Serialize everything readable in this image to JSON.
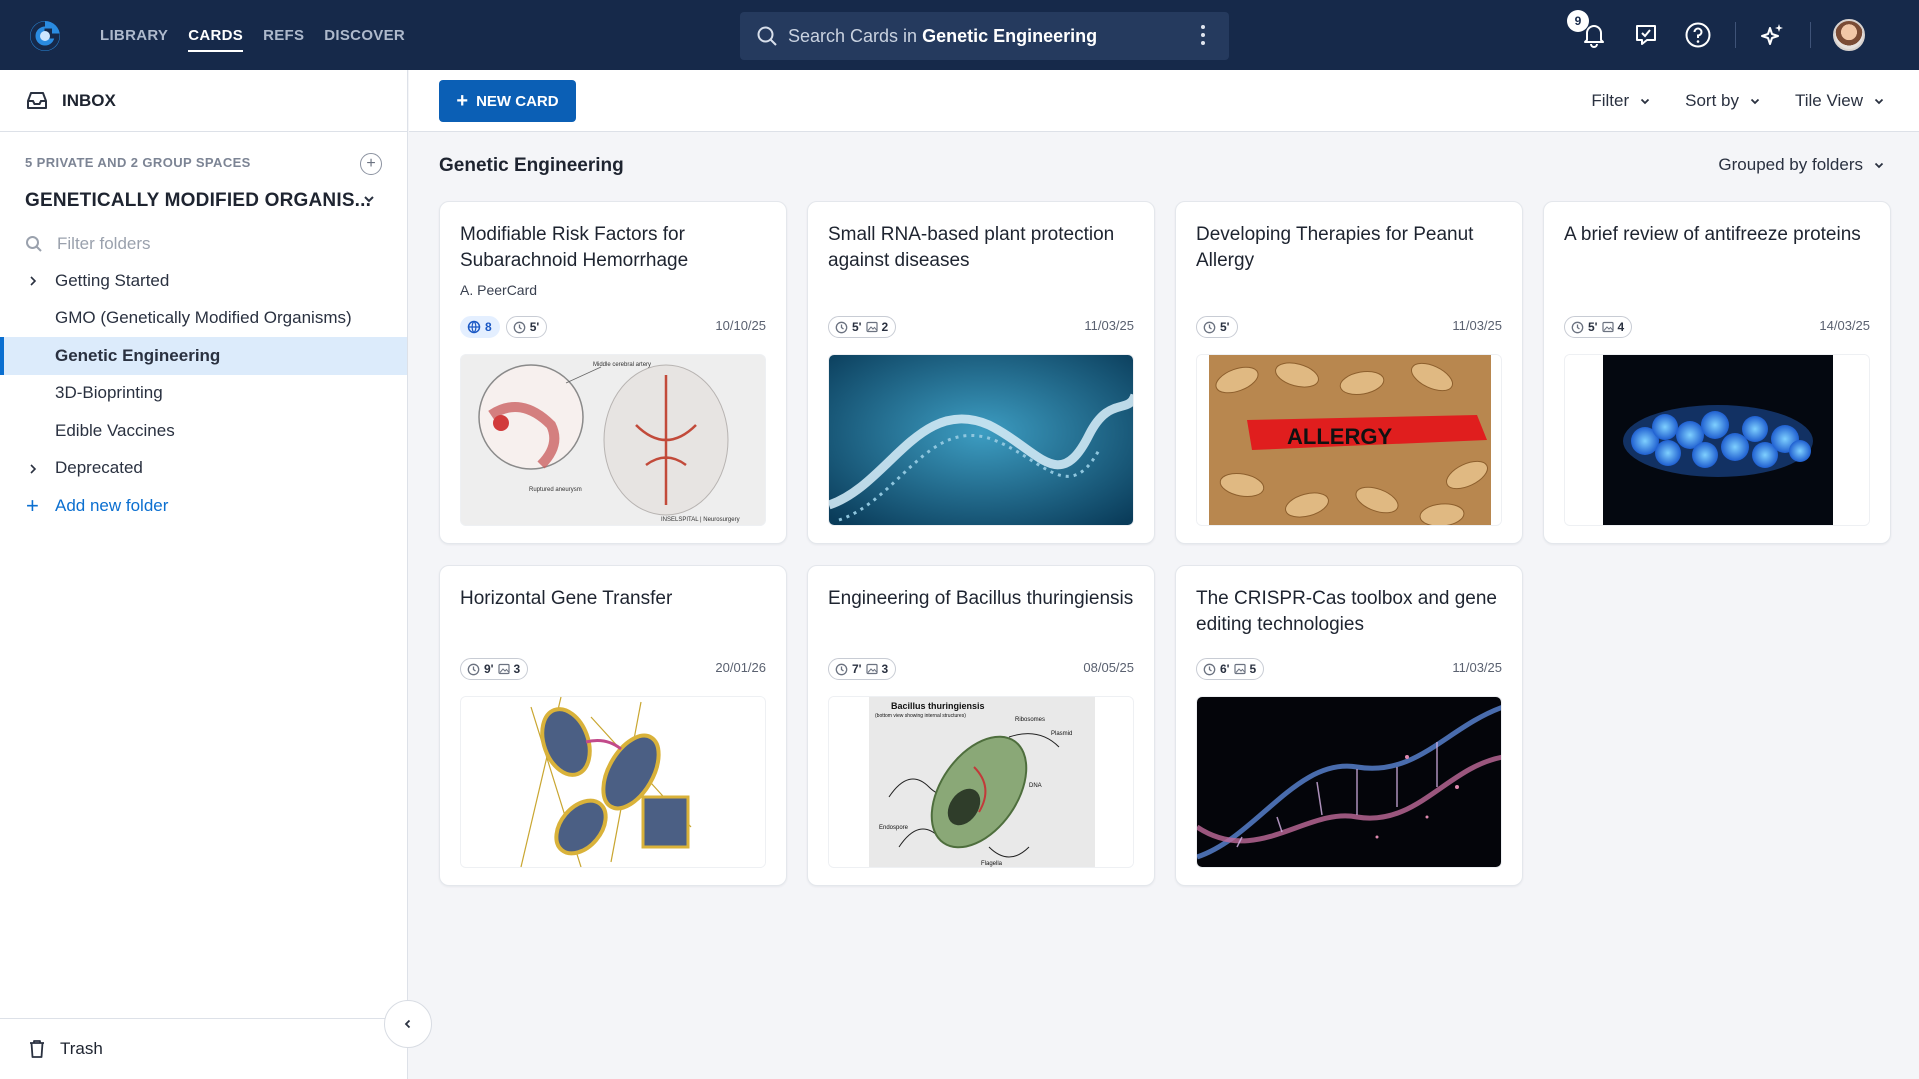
{
  "nav": {
    "items": [
      {
        "label": "LIBRARY",
        "active": false
      },
      {
        "label": "CARDS",
        "active": true
      },
      {
        "label": "REFS",
        "active": false
      },
      {
        "label": "DISCOVER",
        "active": false
      }
    ]
  },
  "search": {
    "prefix": "Search Cards in",
    "scope": "Genetic Engineering"
  },
  "notifications": {
    "count": "9"
  },
  "sidebar": {
    "inbox_label": "INBOX",
    "spaces_label": "5 PRIVATE AND 2 GROUP SPACES",
    "space_name": "GENETICALLY MODIFIED ORGANIS...",
    "filter_placeholder": "Filter folders",
    "folders": [
      {
        "label": "Getting Started",
        "expandable": true,
        "selected": false
      },
      {
        "label": "GMO (Genetically Modified Organisms)",
        "expandable": false,
        "selected": false
      },
      {
        "label": "Genetic Engineering",
        "expandable": false,
        "selected": true
      },
      {
        "label": "3D-Bioprinting",
        "expandable": false,
        "selected": false
      },
      {
        "label": "Edible Vaccines",
        "expandable": false,
        "selected": false
      },
      {
        "label": "Deprecated",
        "expandable": true,
        "selected": false
      }
    ],
    "add_folder_label": "Add new folder",
    "trash_label": "Trash"
  },
  "toolbar": {
    "new_card_label": "NEW CARD",
    "filter_label": "Filter",
    "sort_label": "Sort by",
    "view_label": "Tile View"
  },
  "content": {
    "title": "Genetic Engineering",
    "grouping_label": "Grouped by folders"
  },
  "cards": [
    {
      "title": "Modifiable Risk Factors for Subarachnoid Hemorrhage",
      "author": "A. PeerCard",
      "shared": "8",
      "time": "5'",
      "images": "",
      "date": "10/10/25",
      "image": "brain-aneurysm-illustration",
      "image_labels": [
        "Middle cerebral artery",
        "Ruptured aneurysm",
        "INSELSPITAL | Neurosurgery"
      ]
    },
    {
      "title": "Small RNA-based plant protection against diseases",
      "author": "",
      "shared": "",
      "time": "5'",
      "images": "2",
      "date": "11/03/25",
      "image": "rna-strand-render",
      "image_labels": []
    },
    {
      "title": "Developing Therapies for Peanut Allergy",
      "author": "",
      "shared": "",
      "time": "5'",
      "images": "",
      "date": "11/03/25",
      "image": "peanuts-allergy-tag",
      "image_labels": [
        "ALLERGY"
      ]
    },
    {
      "title": "A brief review of antifreeze proteins",
      "author": "",
      "shared": "",
      "time": "5'",
      "images": "4",
      "date": "14/03/25",
      "image": "protein-molecule-render",
      "image_labels": []
    },
    {
      "title": "Horizontal Gene Transfer",
      "author": "",
      "shared": "",
      "time": "9'",
      "images": "3",
      "date": "20/01/26",
      "image": "bacteria-conjugation-illustration",
      "image_labels": []
    },
    {
      "title": "Engineering of Bacillus thuringiensis",
      "author": "",
      "shared": "",
      "time": "7'",
      "images": "3",
      "date": "08/05/25",
      "image": "bacillus-diagram",
      "image_labels": [
        "Bacillus thuringiensis",
        "(bottom view showing internal structures)",
        "Ribosomes",
        "Plasmid",
        "DNA",
        "Endospore",
        "Flagella"
      ]
    },
    {
      "title": "The CRISPR-Cas toolbox and gene editing technologies",
      "author": "",
      "shared": "",
      "time": "6'",
      "images": "5",
      "date": "11/03/25",
      "image": "dna-helix-render",
      "image_labels": []
    }
  ],
  "colors": {
    "topbar": "#16294a",
    "accent": "#0b5fb5",
    "selected": "#dcebfb"
  }
}
